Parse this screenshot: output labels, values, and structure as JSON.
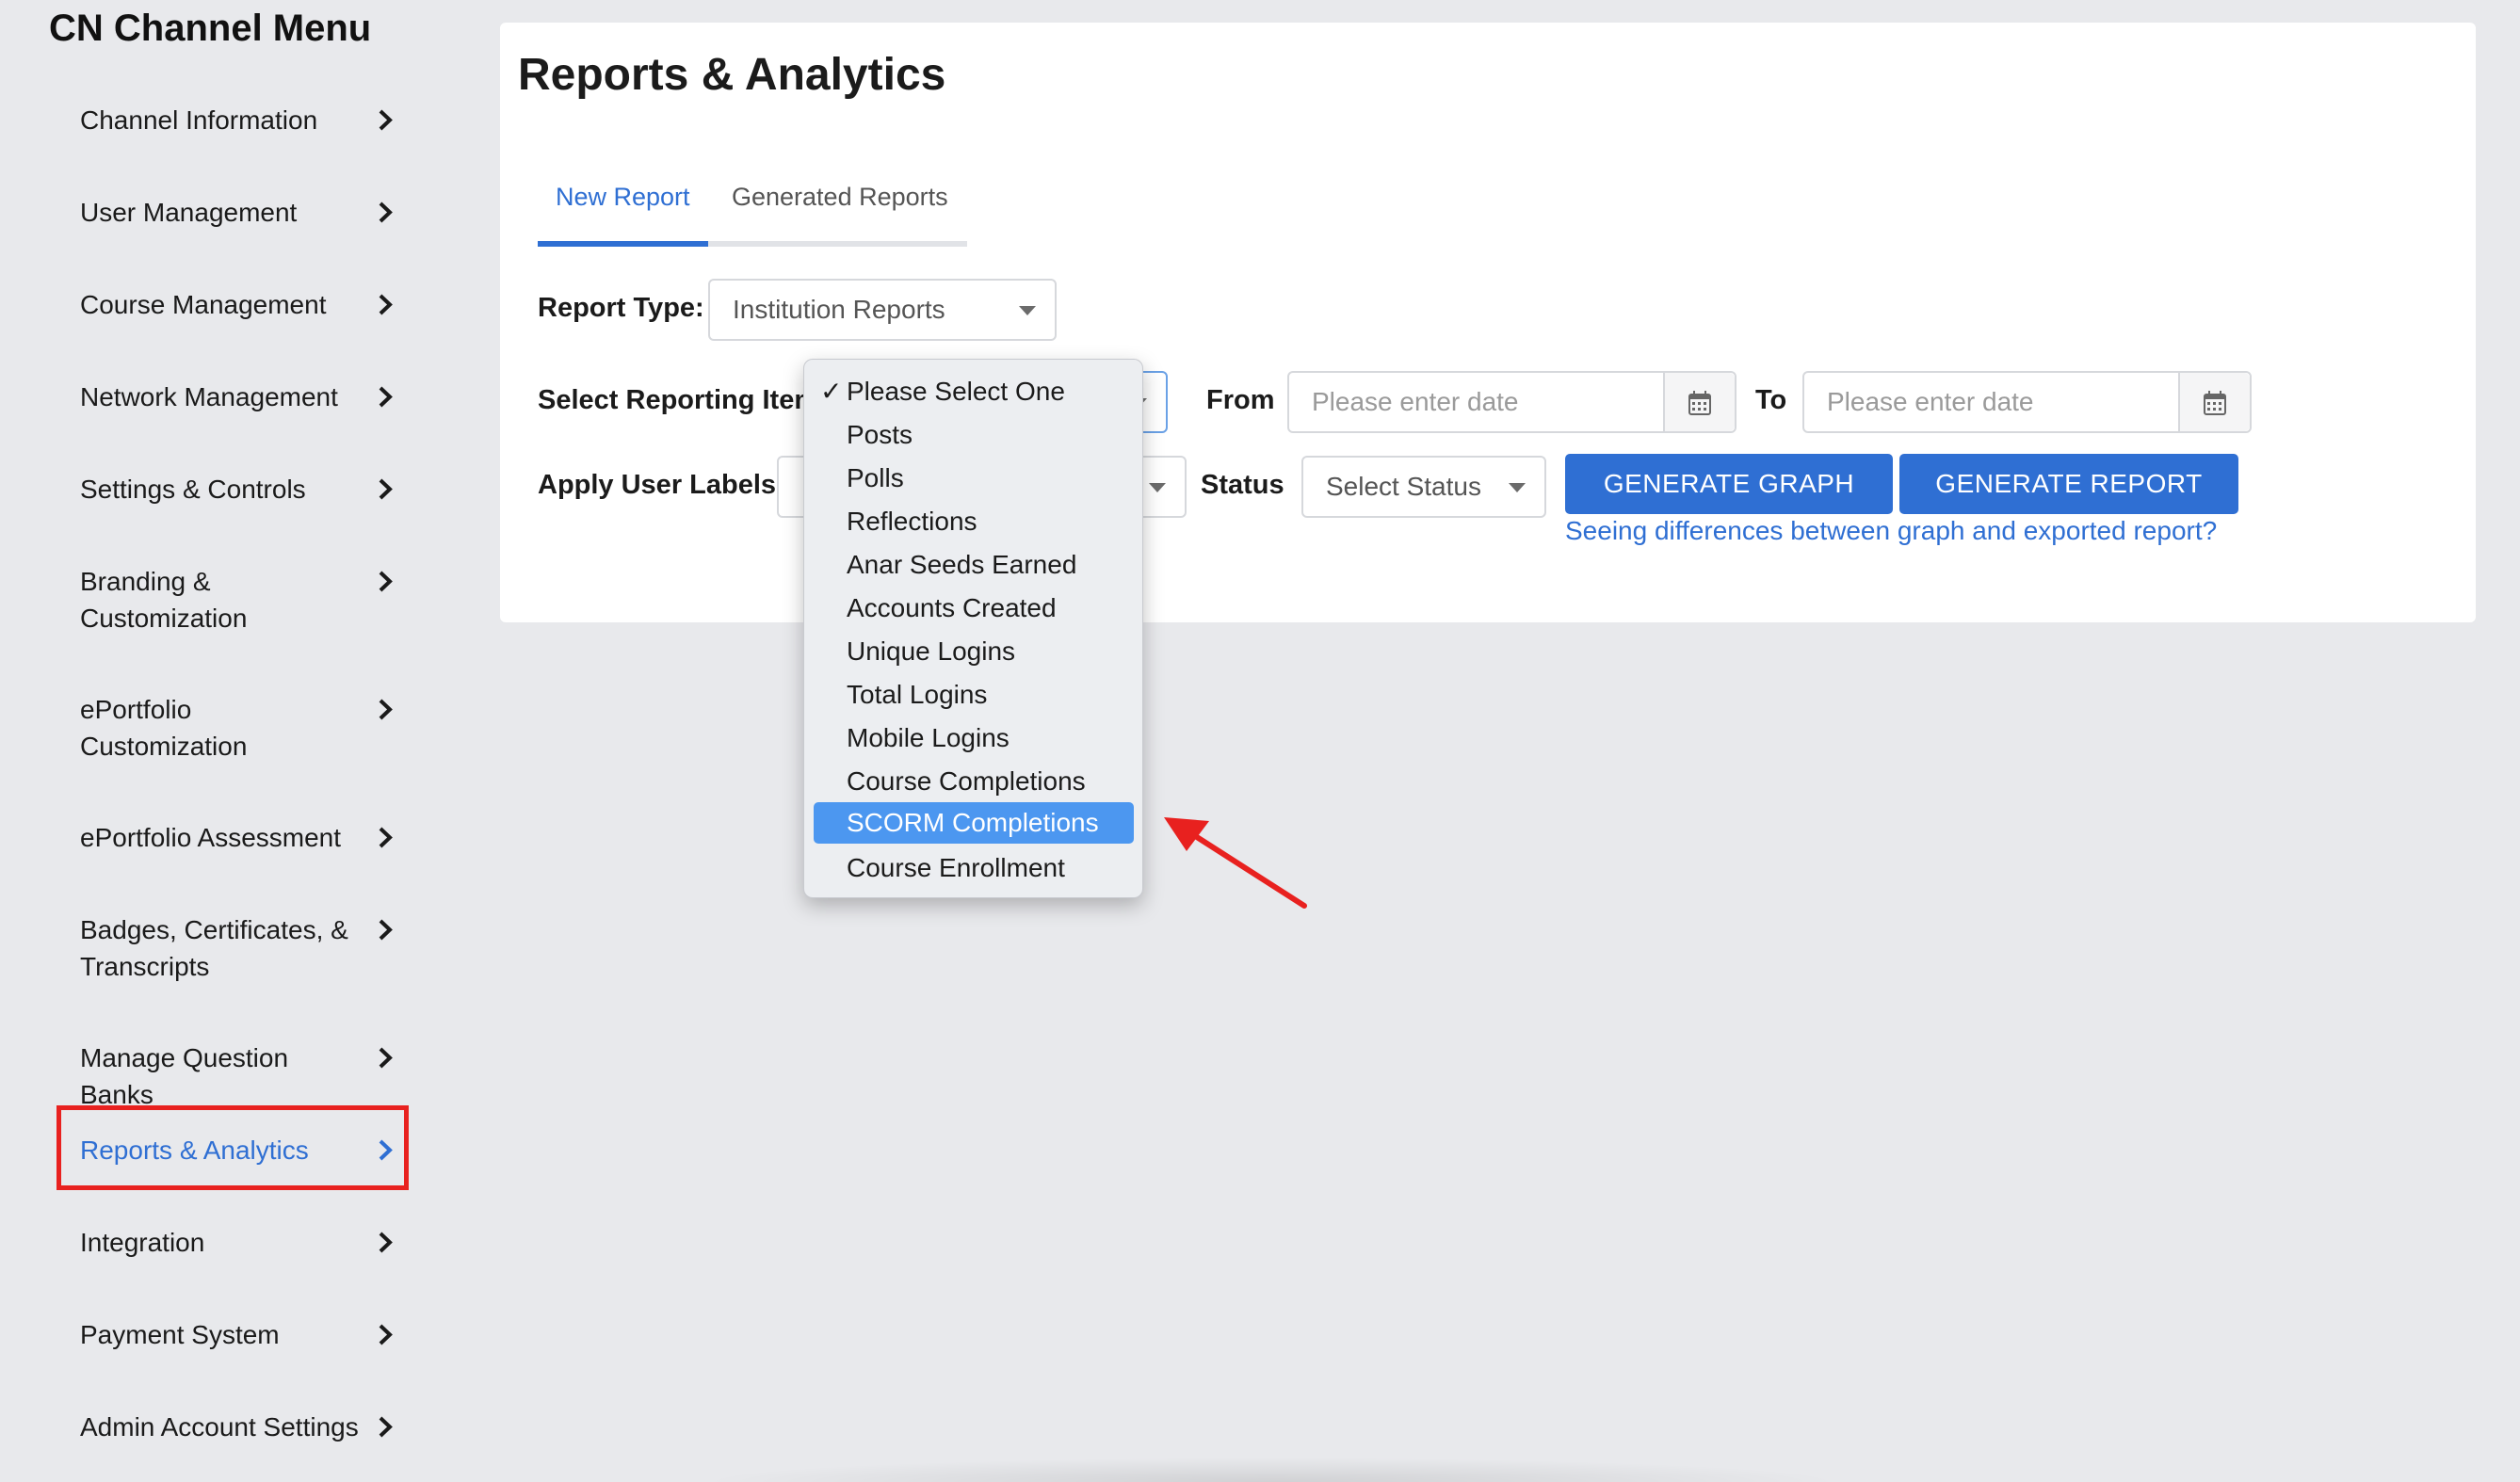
{
  "sidebar": {
    "title": "CN Channel Menu",
    "items": [
      {
        "label": "Channel Information"
      },
      {
        "label": "User Management"
      },
      {
        "label": "Course Management"
      },
      {
        "label": "Network Management"
      },
      {
        "label": "Settings & Controls"
      },
      {
        "label": "Branding & Customization"
      },
      {
        "label": "ePortfolio Customization"
      },
      {
        "label": "ePortfolio Assessment"
      },
      {
        "label": "Badges, Certificates, & Transcripts"
      },
      {
        "label": "Manage Question Banks"
      },
      {
        "label": "Reports & Analytics"
      },
      {
        "label": "Integration"
      },
      {
        "label": "Payment System"
      },
      {
        "label": "Admin Account Settings"
      }
    ]
  },
  "main": {
    "title": "Reports & Analytics",
    "tabs": [
      {
        "label": "New Report"
      },
      {
        "label": "Generated Reports"
      }
    ],
    "report_type": {
      "label": "Report Type:",
      "value": "Institution Reports"
    },
    "reporting_item": {
      "label": "Select Reporting Item"
    },
    "from": {
      "label": "From",
      "placeholder": "Please enter date"
    },
    "to": {
      "label": "To",
      "placeholder": "Please enter date"
    },
    "user_labels": {
      "label": "Apply User Labels"
    },
    "status": {
      "label": "Status",
      "value": "Select Status"
    },
    "buttons": {
      "graph": "GENERATE GRAPH",
      "report": "GENERATE REPORT"
    },
    "diff_link": "Seeing differences between graph and exported report?"
  },
  "dropdown": {
    "options": [
      "Please Select One",
      "Posts",
      "Polls",
      "Reflections",
      "Anar Seeds Earned",
      "Accounts Created",
      "Unique Logins",
      "Total Logins",
      "Mobile Logins",
      "Course Completions",
      "SCORM Completions",
      "Course Enrollment"
    ],
    "checked": "Please Select One",
    "highlighted": "SCORM Completions"
  },
  "colors": {
    "accent": "#2f6fd3",
    "annotation": "#e8211f",
    "highlight": "#4c97f0"
  }
}
